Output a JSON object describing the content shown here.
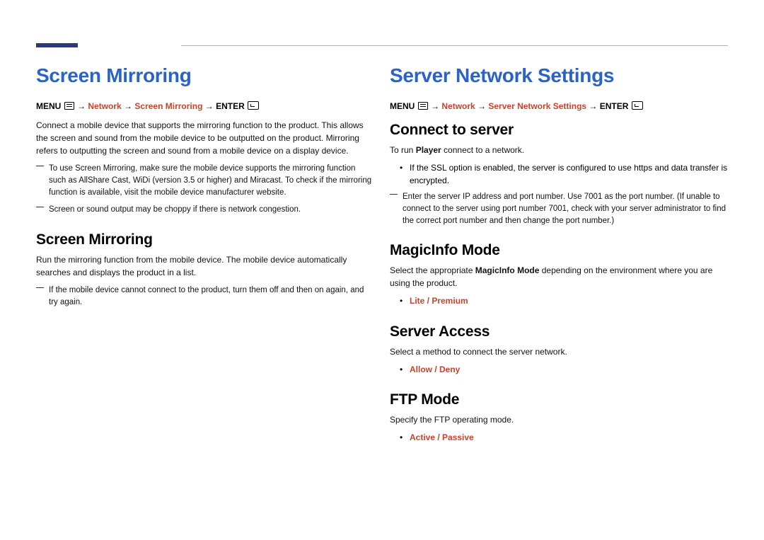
{
  "left": {
    "title": "Screen Mirroring",
    "nav": {
      "menu": "MENU",
      "path1": "Network",
      "path2": "Screen Mirroring",
      "enter": "ENTER"
    },
    "intro": "Connect a mobile device that supports the mirroring function to the product. This allows the screen and sound from the mobile device to be outputted on the product. Mirroring refers to outputting the screen and sound from a mobile device on a display device.",
    "note1_a": "To use ",
    "note1_b": "Screen Mirroring",
    "note1_c": ", make sure the mobile device supports the mirroring function such as AllShare Cast, WiDi (version 3.5 or higher) and Miracast. To check if the mirroring function is available, visit the mobile device manufacturer website.",
    "note2": "Screen or sound output may be choppy if there is network congestion.",
    "sub_title": "Screen Mirroring",
    "sub_p": "Run the mirroring function from the mobile device. The mobile device automatically searches and displays the product in a list.",
    "sub_note": "If the mobile device cannot connect to the product, turn them off and then on again, and try again."
  },
  "right": {
    "title": "Server Network Settings",
    "nav": {
      "menu": "MENU",
      "path1": "Network",
      "path2": "Server Network Settings",
      "enter": "ENTER"
    },
    "connect": {
      "h": "Connect to server",
      "p_a": "To run ",
      "p_b": "Player",
      "p_c": " connect to a network.",
      "b1_a": "If the ",
      "b1_b": "SSL",
      "b1_c": " option is enabled, the server is configured to use ",
      "b1_d": "https",
      "b1_e": " and data transfer is encrypted.",
      "note": "Enter the server IP address and port number. Use 7001 as the port number. (If unable to connect to the server using port number 7001, check with your server administrator to find the correct port number and then change the port number.)"
    },
    "magic": {
      "h": "MagicInfo Mode",
      "p_a": "Select the appropriate ",
      "p_b": "MagicInfo Mode",
      "p_c": " depending on the environment where you are using the product.",
      "opt": "Lite / Premium"
    },
    "access": {
      "h": "Server Access",
      "p": "Select a method to connect the server network.",
      "opt": "Allow / Deny"
    },
    "ftp": {
      "h": "FTP Mode",
      "p": "Specify the FTP operating mode.",
      "opt": "Active / Passive"
    }
  }
}
